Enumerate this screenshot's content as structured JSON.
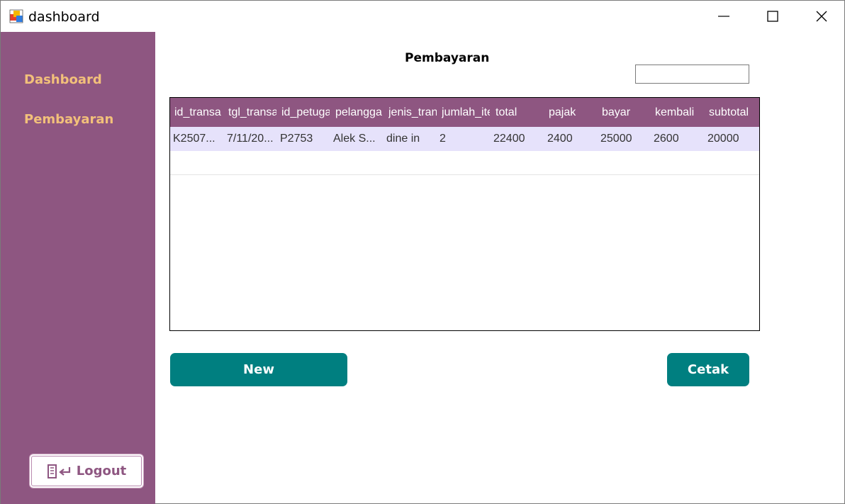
{
  "window": {
    "title": "dashboard",
    "icon": "app-window-icon",
    "controls": [
      "minimize-icon",
      "maximize-icon",
      "close-icon"
    ]
  },
  "sidebar": {
    "background": "#8e5681",
    "items": [
      {
        "label": "Dashboard"
      },
      {
        "label": "Pembayaran"
      }
    ],
    "logout": {
      "label": "Logout",
      "icon": "logout-icon"
    }
  },
  "main": {
    "title": "Pembayaran",
    "search": {
      "value": "",
      "placeholder": ""
    },
    "table": {
      "columns": [
        "id_transa",
        "tgl_transa",
        "id_petuga",
        "pelangga",
        "jenis_tran",
        "jumlah_ite",
        "total",
        "pajak",
        "bayar",
        "kembali",
        "subtotal"
      ],
      "rows": [
        [
          "K2507...",
          "7/11/20...",
          "P2753",
          "Alek S...",
          "dine in",
          "2",
          "22400",
          "2400",
          "25000",
          "2600",
          "20000"
        ]
      ]
    },
    "buttons": {
      "new_label": "New",
      "print_label": "Cetak"
    }
  },
  "colors": {
    "sidebar": "#8e5681",
    "nav_text": "#f2c07a",
    "button": "#007f80",
    "selected_row": "#e6e2fb"
  }
}
